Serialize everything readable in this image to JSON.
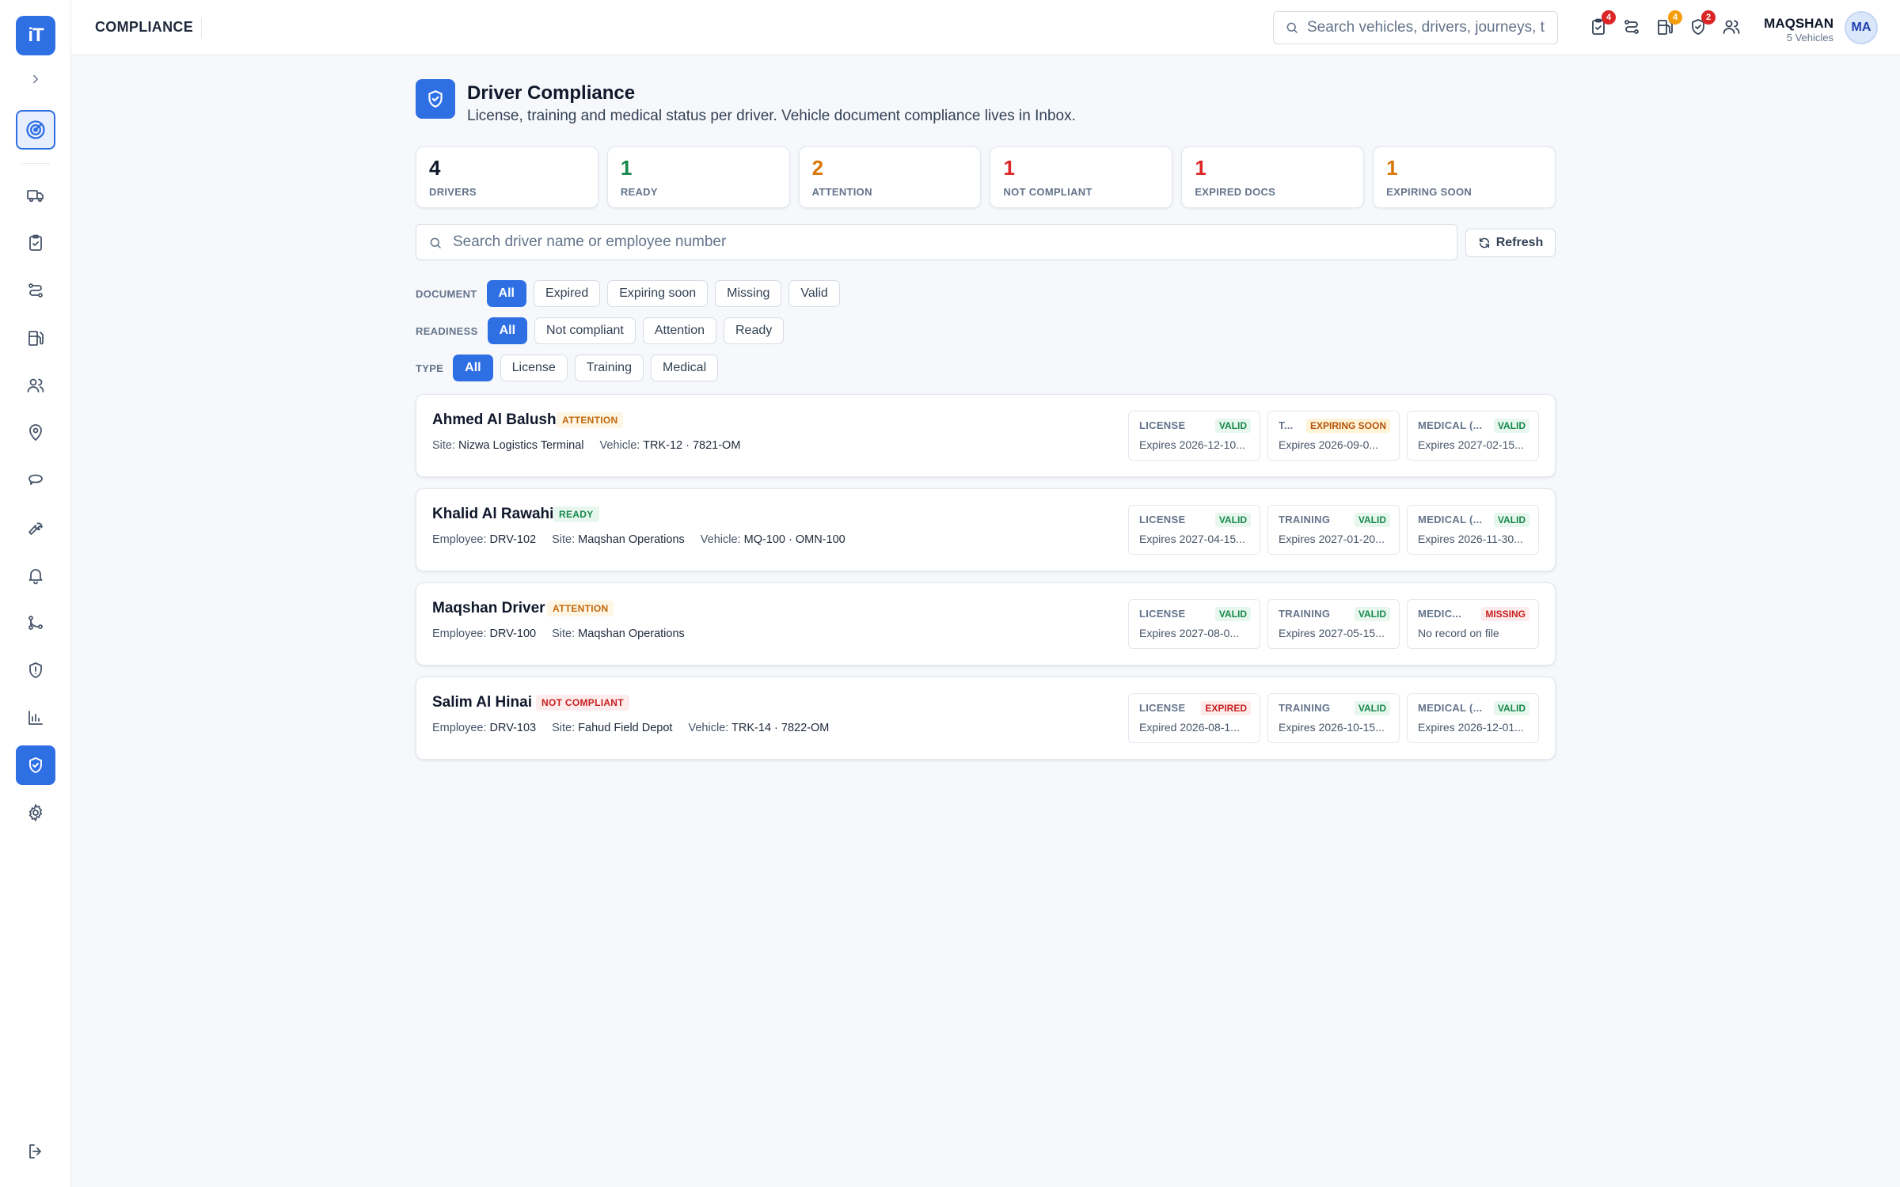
{
  "app": {
    "logo": "iT",
    "section_title": "COMPLIANCE"
  },
  "topbar": {
    "search_placeholder": "Search vehicles, drivers, journeys, t",
    "icons": [
      {
        "name": "clipboard-check-icon",
        "badge": "4",
        "badge_color": "#dc2626"
      },
      {
        "name": "route-icon",
        "badge": ""
      },
      {
        "name": "fuel-icon",
        "badge": "4",
        "badge_color": "#f59e0b"
      },
      {
        "name": "shield-check-icon",
        "badge": "2",
        "badge_color": "#dc2626"
      },
      {
        "name": "users-icon",
        "badge": ""
      }
    ],
    "user_name": "MAQSHAN",
    "user_sub": "5 Vehicles",
    "avatar": "MA"
  },
  "page": {
    "title": "Driver Compliance",
    "subtitle": "License, training and medical status per driver. Vehicle document compliance lives in Inbox."
  },
  "stats": [
    {
      "value": "4",
      "label": "DRIVERS",
      "color": "#0f172a"
    },
    {
      "value": "1",
      "label": "READY",
      "color": "#16884a"
    },
    {
      "value": "2",
      "label": "ATTENTION",
      "color": "#d97706"
    },
    {
      "value": "1",
      "label": "NOT COMPLIANT",
      "color": "#dc2626"
    },
    {
      "value": "1",
      "label": "EXPIRED DOCS",
      "color": "#dc2626"
    },
    {
      "value": "1",
      "label": "EXPIRING SOON",
      "color": "#d97706"
    }
  ],
  "driver_search_placeholder": "Search driver name or employee number",
  "refresh_label": "Refresh",
  "filters": [
    {
      "label": "DOCUMENT",
      "options": [
        "All",
        "Expired",
        "Expiring soon",
        "Missing",
        "Valid"
      ],
      "selected": "All"
    },
    {
      "label": "READINESS",
      "options": [
        "All",
        "Not compliant",
        "Attention",
        "Ready"
      ],
      "selected": "All"
    },
    {
      "label": "TYPE",
      "options": [
        "All",
        "License",
        "Training",
        "Medical"
      ],
      "selected": "All"
    }
  ],
  "drivers": [
    {
      "name": "Ahmed Al Balushi",
      "status": "ATTENTION",
      "status_kind": "attention",
      "meta": [
        {
          "k": "Site:",
          "v": "Nizwa Logistics Terminal"
        },
        {
          "k": "Vehicle:",
          "v": "TRK-12 · 7821-OM"
        }
      ],
      "docs": [
        {
          "label": "LICENSE",
          "status": "VALID",
          "kind": "valid",
          "detail": "Expires 2026-12-10..."
        },
        {
          "label": "T...",
          "status": "EXPIRING SOON",
          "kind": "soon",
          "detail": "Expires 2026-09-0..."
        },
        {
          "label": "MEDICAL (...",
          "status": "VALID",
          "kind": "valid",
          "detail": "Expires 2027-02-15..."
        }
      ]
    },
    {
      "name": "Khalid Al Rawahi",
      "status": "READY",
      "status_kind": "ready",
      "meta": [
        {
          "k": "Employee:",
          "v": "DRV-102"
        },
        {
          "k": "Site:",
          "v": "Maqshan Operations"
        },
        {
          "k": "Vehicle:",
          "v": "MQ-100 · OMN-100"
        }
      ],
      "docs": [
        {
          "label": "LICENSE",
          "status": "VALID",
          "kind": "valid",
          "detail": "Expires 2027-04-15..."
        },
        {
          "label": "TRAINING",
          "status": "VALID",
          "kind": "valid",
          "detail": "Expires 2027-01-20..."
        },
        {
          "label": "MEDICAL (...",
          "status": "VALID",
          "kind": "valid",
          "detail": "Expires 2026-11-30..."
        }
      ]
    },
    {
      "name": "Maqshan Driver",
      "status": "ATTENTION",
      "status_kind": "attention",
      "meta": [
        {
          "k": "Employee:",
          "v": "DRV-100"
        },
        {
          "k": "Site:",
          "v": "Maqshan Operations"
        }
      ],
      "docs": [
        {
          "label": "LICENSE",
          "status": "VALID",
          "kind": "valid",
          "detail": "Expires 2027-08-0..."
        },
        {
          "label": "TRAINING",
          "status": "VALID",
          "kind": "valid",
          "detail": "Expires 2027-05-15..."
        },
        {
          "label": "MEDIC...",
          "status": "MISSING",
          "kind": "missing",
          "detail": "No record on file"
        }
      ]
    },
    {
      "name": "Salim Al Hinai",
      "status": "NOT COMPLIANT",
      "status_kind": "notcomp",
      "meta": [
        {
          "k": "Employee:",
          "v": "DRV-103"
        },
        {
          "k": "Site:",
          "v": "Fahud Field Depot"
        },
        {
          "k": "Vehicle:",
          "v": "TRK-14 · 7822-OM"
        }
      ],
      "docs": [
        {
          "label": "LICENSE",
          "status": "EXPIRED",
          "kind": "expired",
          "detail": "Expired 2026-08-1..."
        },
        {
          "label": "TRAINING",
          "status": "VALID",
          "kind": "valid",
          "detail": "Expires 2026-10-15..."
        },
        {
          "label": "MEDICAL (...",
          "status": "VALID",
          "kind": "valid",
          "detail": "Expires 2026-12-01..."
        }
      ]
    }
  ]
}
